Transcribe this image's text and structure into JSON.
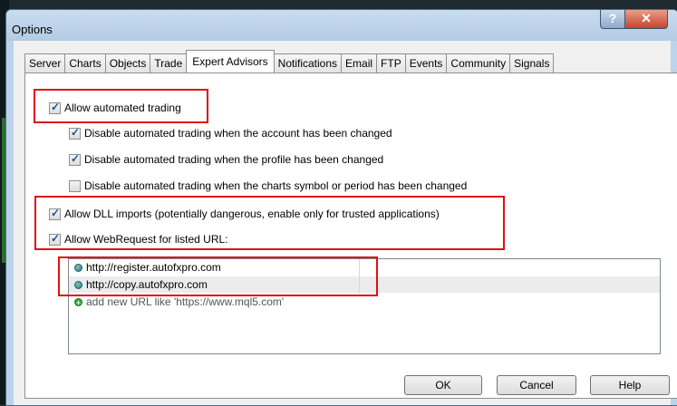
{
  "window": {
    "title": "Options"
  },
  "tabs": [
    "Server",
    "Charts",
    "Objects",
    "Trade",
    "Expert Advisors",
    "Notifications",
    "Email",
    "FTP",
    "Events",
    "Community",
    "Signals"
  ],
  "active_tab": "Expert Advisors",
  "options": {
    "allow_automated": {
      "label": "Allow automated trading",
      "checked": true
    },
    "disable_account": {
      "label": "Disable automated trading when the account has been changed",
      "checked": true
    },
    "disable_profile": {
      "label": "Disable automated trading when the profile has been changed",
      "checked": true
    },
    "disable_symbol": {
      "label": "Disable automated trading when the charts symbol or period has been changed",
      "checked": false
    },
    "allow_dll": {
      "label": "Allow DLL imports (potentially dangerous, enable only for trusted applications)",
      "checked": true
    },
    "allow_webrequest": {
      "label": "Allow WebRequest for listed URL:",
      "checked": true
    }
  },
  "urls": [
    "http://register.autofxpro.com",
    "http://copy.autofxpro.com"
  ],
  "add_url_placeholder": "add new URL like 'https://www.mql5.com'",
  "buttons": {
    "ok": "OK",
    "cancel": "Cancel",
    "help": "Help"
  },
  "annotation_color": "#e01010"
}
